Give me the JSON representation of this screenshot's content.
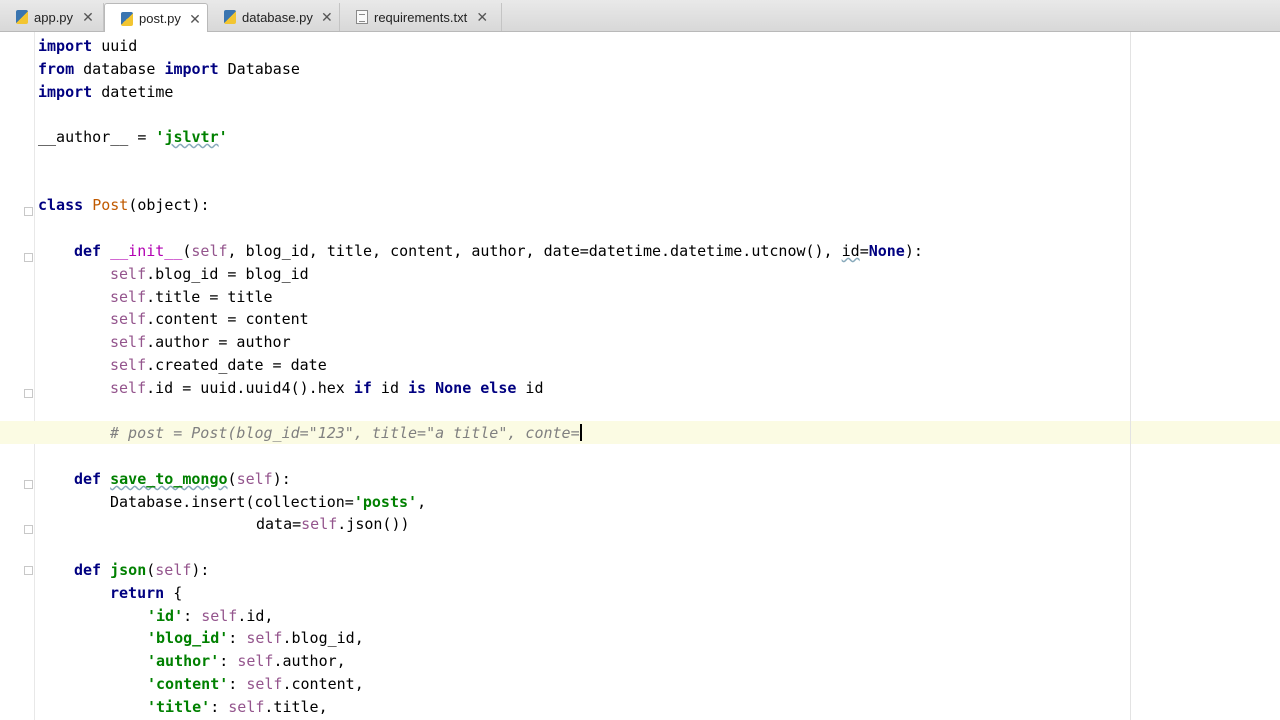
{
  "tabs": [
    {
      "label": "app.py",
      "icon": "python-file-icon",
      "active": false
    },
    {
      "label": "post.py",
      "icon": "python-file-icon",
      "active": true
    },
    {
      "label": "database.py",
      "icon": "python-file-icon",
      "active": false
    },
    {
      "label": "requirements.txt",
      "icon": "text-file-icon",
      "active": false
    }
  ],
  "close_glyph": "✕",
  "code": {
    "l1_kw": "import",
    "l1_rest": " uuid",
    "l2_kw1": "from",
    "l2_mid": " database ",
    "l2_kw2": "import",
    "l2_rest": " Database",
    "l3_kw": "import",
    "l3_rest": " datetime",
    "l4_name": "__author__",
    "l4_eq": " = ",
    "l4_q1": "'",
    "l4_val": "jslvtr",
    "l4_q2": "'",
    "l5_kw": "class",
    "l5_sp": " ",
    "l5_name": "Post",
    "l5_rest": "(object):",
    "l6_kw": "def",
    "l6_sp": " ",
    "l6_name": "__init__",
    "l6_p1": "(",
    "l6_self": "self",
    "l6_p2": ", blog_id, title, content, author, date=datetime.datetime.utcnow(), ",
    "l6_id": "id",
    "l6_p3": "=",
    "l6_none": "None",
    "l6_p4": "):",
    "l7_self": "self",
    "l7_rest": ".blog_id = blog_id",
    "l8_self": "self",
    "l8_rest": ".title = title",
    "l9_self": "self",
    "l9_rest": ".content = content",
    "l10_self": "self",
    "l10_rest": ".author = author",
    "l11_self": "self",
    "l11_rest": ".created_date = date",
    "l12_self": "self",
    "l12_a": ".id = uuid.uuid4().hex ",
    "l12_if": "if",
    "l12_b": " id ",
    "l12_is": "is",
    "l12_c": " ",
    "l12_none": "None",
    "l12_d": " ",
    "l12_else": "else",
    "l12_e": " id",
    "l13_comment": "# post = Post(blog_id=\"123\", title=\"a title\", conte=",
    "l14_kw": "def",
    "l14_sp": " ",
    "l14_name": "save_to_mongo",
    "l14_p1": "(",
    "l14_self": "self",
    "l14_p2": "):",
    "l15_a": "Database.insert(collection=",
    "l15_str": "'posts'",
    "l15_b": ",",
    "l16_a": "data=",
    "l16_self": "self",
    "l16_b": ".json())",
    "l17_kw": "def",
    "l17_sp": " ",
    "l17_name": "json",
    "l17_p1": "(",
    "l17_self": "self",
    "l17_p2": "):",
    "l18_kw": "return",
    "l18_rest": " {",
    "l19_str": "'id'",
    "l19_a": ": ",
    "l19_self": "self",
    "l19_b": ".id,",
    "l20_str": "'blog_id'",
    "l20_a": ": ",
    "l20_self": "self",
    "l20_b": ".blog_id,",
    "l21_str": "'author'",
    "l21_a": ": ",
    "l21_self": "self",
    "l21_b": ".author,",
    "l22_str": "'content'",
    "l22_a": ": ",
    "l22_self": "self",
    "l22_b": ".content,",
    "l23_str": "'title'",
    "l23_a": ": ",
    "l23_self": "self",
    "l23_b": ".title,"
  }
}
